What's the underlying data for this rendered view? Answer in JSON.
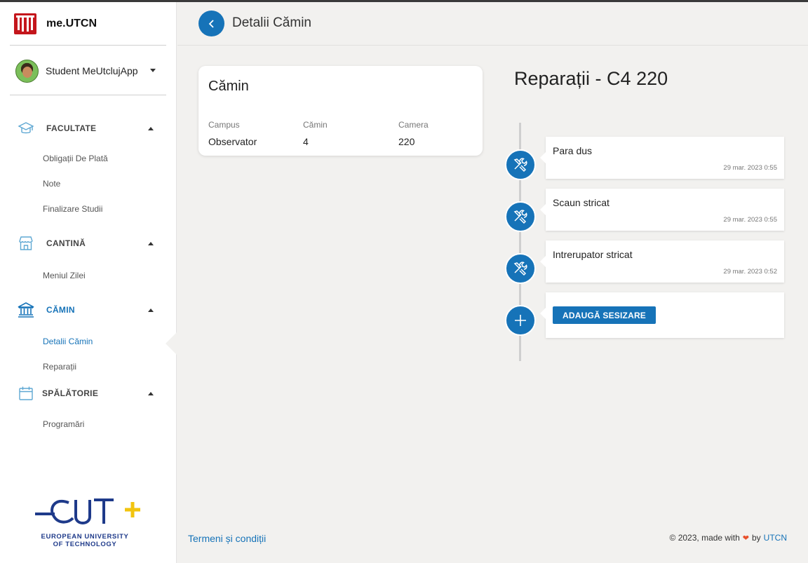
{
  "brand": {
    "name": "me.UTCN"
  },
  "user": {
    "name": "Student MeUtclujApp"
  },
  "sidebar": {
    "sections": [
      {
        "label": "FACULTATE",
        "items": [
          "Obligații De Plată",
          "Note",
          "Finalizare Studii"
        ]
      },
      {
        "label": "CANTINĂ",
        "items": [
          "Meniul Zilei"
        ]
      },
      {
        "label": "CĂMIN",
        "items": [
          "Detalii Cămin",
          "Reparații"
        ]
      },
      {
        "label": "SPĂLĂTORIE",
        "items": [
          "Programări"
        ]
      }
    ],
    "active_item": "Detalii Cămin"
  },
  "eut": {
    "line1": "EUROPEAN UNIVERSITY",
    "line2": "OF TECHNOLOGY"
  },
  "header": {
    "title": "Detalii Cămin"
  },
  "card": {
    "title": "Cămin",
    "columns": [
      {
        "label": "Campus",
        "value": "Observator"
      },
      {
        "label": "Cămin",
        "value": "4"
      },
      {
        "label": "Camera",
        "value": "220"
      }
    ]
  },
  "repairs": {
    "title": "Reparații - C4 220",
    "items": [
      {
        "text": "Para dus",
        "date": "29 mar. 2023 0:55"
      },
      {
        "text": "Scaun stricat",
        "date": "29 mar. 2023 0:55"
      },
      {
        "text": "Intrerupator stricat",
        "date": "29 mar. 2023 0:52"
      }
    ],
    "add_label": "ADAUGĂ SESIZARE"
  },
  "footer": {
    "terms": "Termeni și condiții",
    "made_with": "© 2023, made with",
    "by": "by",
    "org": "UTCN"
  },
  "colors": {
    "accent": "#1673b8",
    "brand_red": "#c4161c",
    "heart": "#e8502b"
  },
  "icons": [
    "graduation-cap-icon",
    "store-icon",
    "bank-icon",
    "calendar-icon",
    "tools-icon",
    "plus-icon",
    "chevron-left-icon"
  ]
}
